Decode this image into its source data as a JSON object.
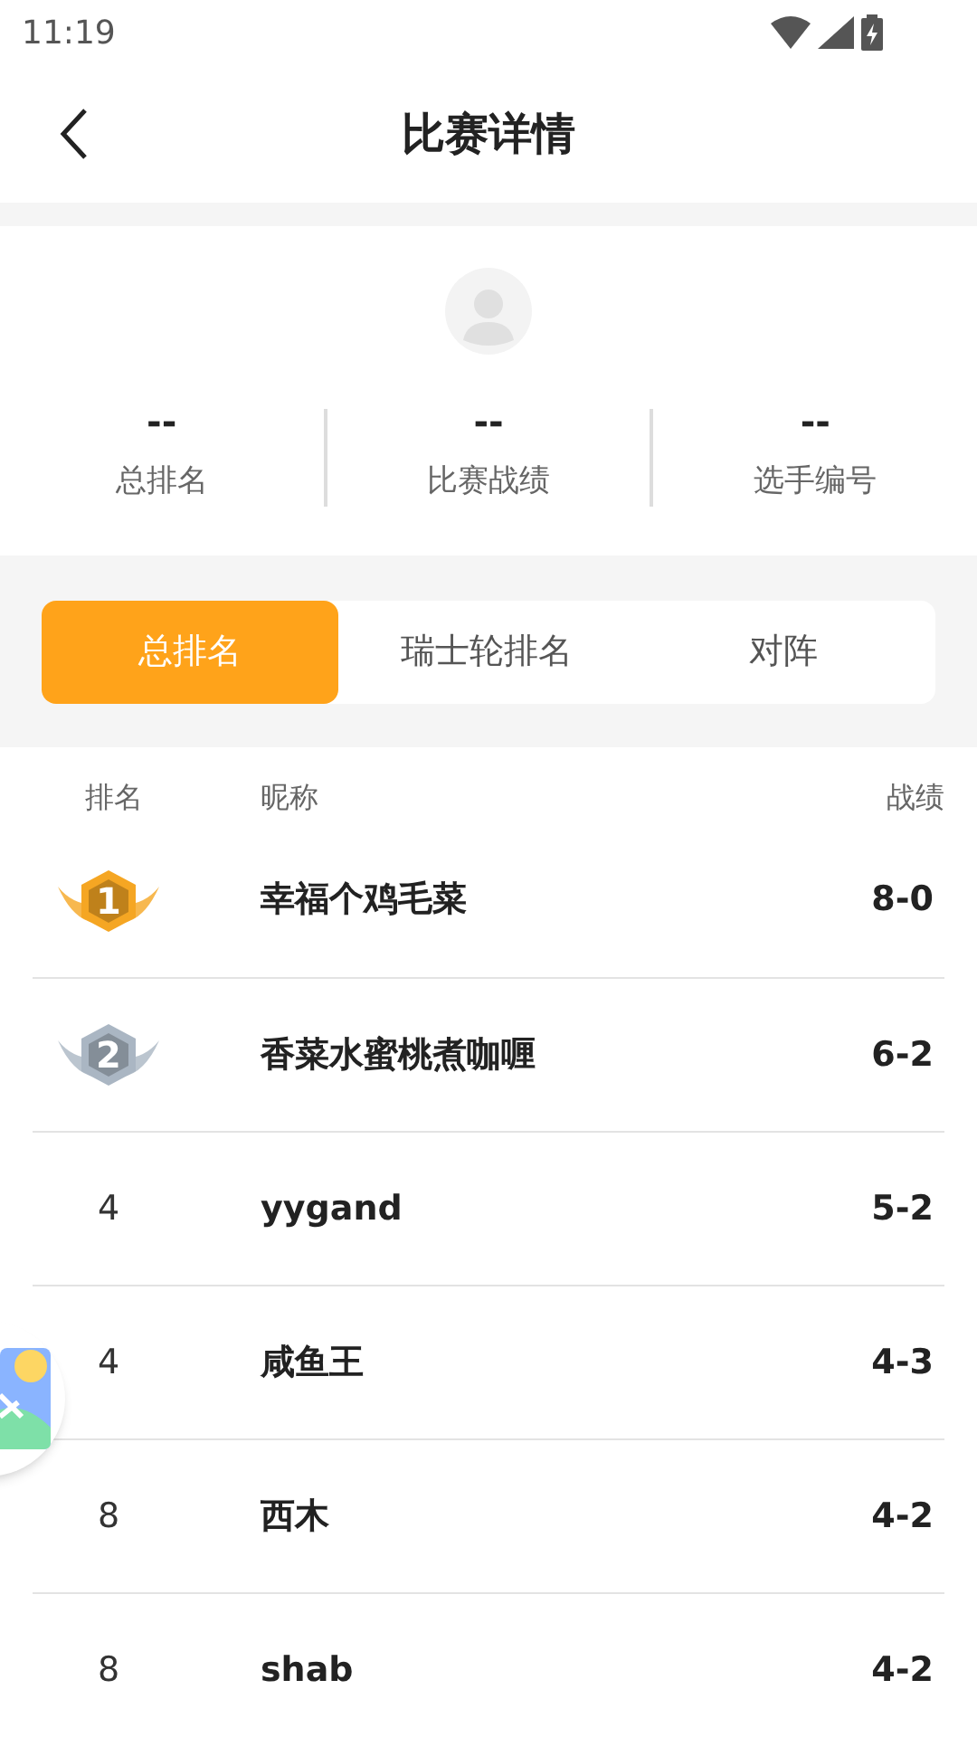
{
  "status_bar": {
    "time": "11:19"
  },
  "header": {
    "title": "比赛详情"
  },
  "profile": {
    "stats": [
      {
        "value": "--",
        "label": "总排名"
      },
      {
        "value": "--",
        "label": "比赛战绩"
      },
      {
        "value": "--",
        "label": "选手编号"
      }
    ]
  },
  "tabs": [
    {
      "label": "总排名",
      "selected": true
    },
    {
      "label": "瑞士轮排名",
      "selected": false
    },
    {
      "label": "对阵",
      "selected": false
    }
  ],
  "table": {
    "columns": [
      "排名",
      "昵称",
      "战绩"
    ],
    "rows": [
      {
        "kind": "medal",
        "color": "#f5a623",
        "rank": "1",
        "name": "幸福个鸡毛菜",
        "record": "8-0"
      },
      {
        "kind": "medal",
        "color": "#aab6c3",
        "rank": "2",
        "name": "香菜水蜜桃煮咖喱",
        "record": "6-2"
      },
      {
        "kind": "plain",
        "rank": "4",
        "name": "yygand",
        "record": "5-2"
      },
      {
        "kind": "plain",
        "rank": "4",
        "name": "咸鱼王",
        "record": "4-3"
      },
      {
        "kind": "plain",
        "rank": "8",
        "name": "西木",
        "record": "4-2"
      },
      {
        "kind": "plain",
        "rank": "8",
        "name": "shab",
        "record": "4-2"
      }
    ]
  }
}
